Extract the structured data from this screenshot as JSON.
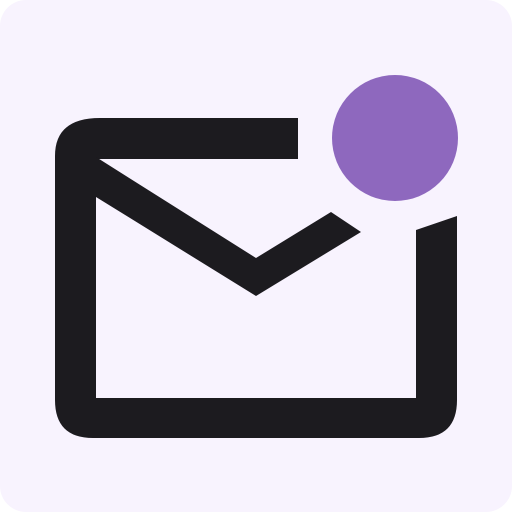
{
  "icon": {
    "name": "mail-notification-icon",
    "glyph": "envelope-icon",
    "badge": "notification-dot-icon",
    "colors": {
      "tile_background": "#F8F3FE",
      "envelope_stroke": "#1C1B1F",
      "badge_fill": "#8E68BE",
      "cutout": "#F8F3FE"
    }
  }
}
